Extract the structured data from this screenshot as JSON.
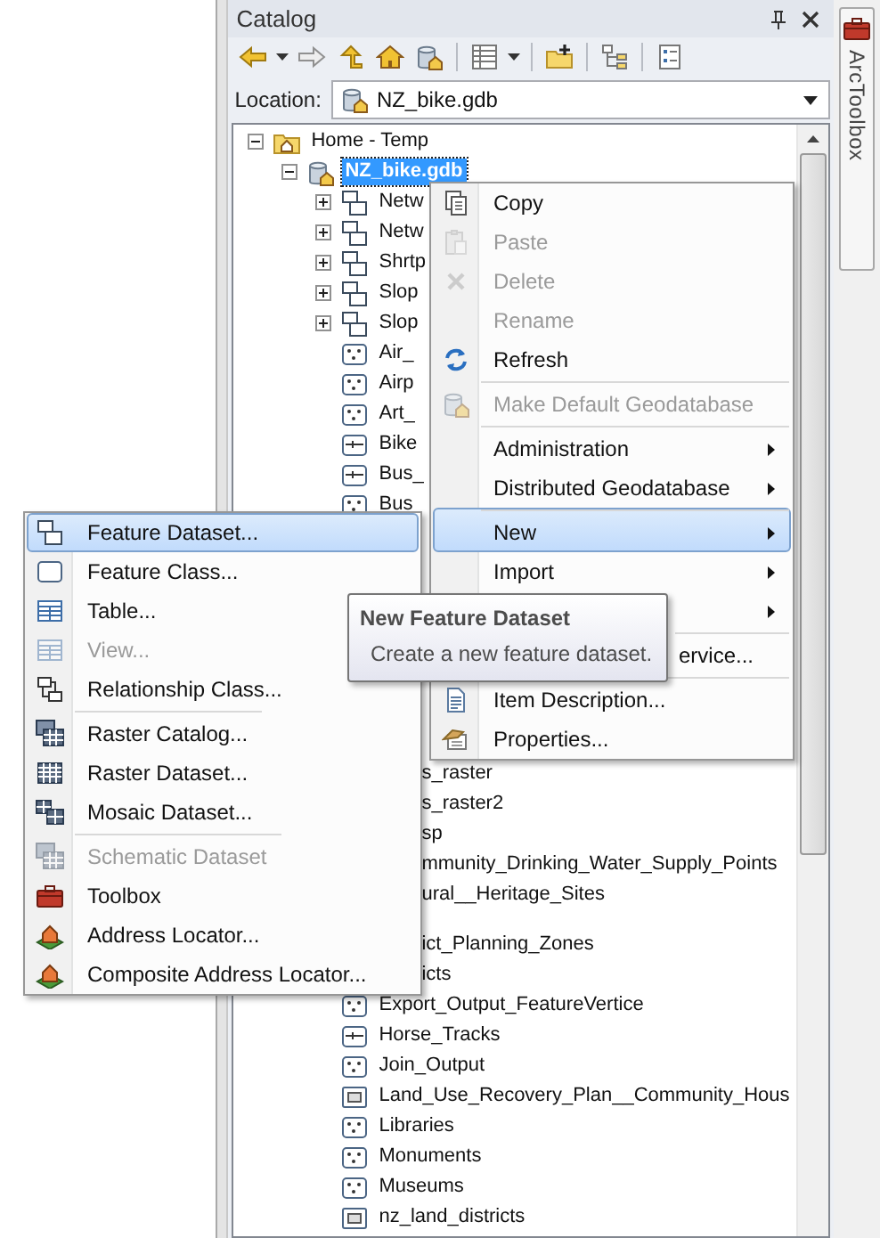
{
  "catalog": {
    "title": "Catalog"
  },
  "location": {
    "label": "Location:",
    "value": "NZ_bike.gdb"
  },
  "side_tab": {
    "label": "ArcToolbox"
  },
  "tree": {
    "items": [
      {
        "label": "Home - Temp",
        "kind": "folder",
        "expanded": true,
        "selected": false,
        "children": [
          {
            "label": "NZ_bike.gdb",
            "kind": "gdb",
            "expanded": true,
            "selected": true,
            "children": [
              {
                "label": "Netw",
                "kind": "dataset",
                "expanded": false,
                "selected": false
              },
              {
                "label": "Netw",
                "kind": "dataset",
                "expanded": false,
                "selected": false
              },
              {
                "label": "Shrtp",
                "kind": "dataset",
                "expanded": false,
                "selected": false
              },
              {
                "label": "Slop",
                "kind": "dataset",
                "expanded": false,
                "selected": false
              },
              {
                "label": "Slop",
                "kind": "dataset",
                "expanded": false,
                "selected": false
              },
              {
                "label": "Air_",
                "kind": "point",
                "selected": false
              },
              {
                "label": "Airp",
                "kind": "point",
                "selected": false
              },
              {
                "label": "Art_",
                "kind": "point",
                "selected": false
              },
              {
                "label": "Bike",
                "kind": "line",
                "selected": false
              },
              {
                "label": "Bus_",
                "kind": "line",
                "selected": false
              },
              {
                "label": "Bus",
                "kind": "point",
                "selected": false
              },
              {
                "label": "s_raster",
                "kind": "clipped",
                "selected": false
              },
              {
                "label": "s_raster2",
                "kind": "clipped",
                "selected": false
              },
              {
                "label": "sp",
                "kind": "clipped",
                "selected": false
              },
              {
                "label": "mmunity_Drinking_Water_Supply_Points",
                "kind": "clipped",
                "selected": false
              },
              {
                "label": "ural__Heritage_Sites",
                "kind": "clipped",
                "selected": false
              },
              {
                "label": "ict_Planning_Zones",
                "kind": "clipped",
                "selected": false
              },
              {
                "label": "icts",
                "kind": "clipped",
                "selected": false
              },
              {
                "label": "Export_Output_FeatureVertice",
                "kind": "point",
                "selected": false
              },
              {
                "label": "Horse_Tracks",
                "kind": "line",
                "selected": false
              },
              {
                "label": "Join_Output",
                "kind": "point",
                "selected": false
              },
              {
                "label": "Land_Use_Recovery_Plan__Community_Hous",
                "kind": "polygon",
                "selected": false
              },
              {
                "label": "Libraries",
                "kind": "point",
                "selected": false
              },
              {
                "label": "Monuments",
                "kind": "point",
                "selected": false
              },
              {
                "label": "Museums",
                "kind": "point",
                "selected": false
              },
              {
                "label": "nz_land_districts",
                "kind": "polygon",
                "selected": false
              }
            ]
          }
        ]
      }
    ]
  },
  "context_menu": {
    "items": [
      {
        "label": "Copy",
        "kind": "plain",
        "disabled": false,
        "submenu": false,
        "selected": false,
        "separator_before": false
      },
      {
        "label": "Paste",
        "kind": "plain",
        "disabled": true,
        "submenu": false,
        "selected": false,
        "separator_before": false
      },
      {
        "label": "Delete",
        "kind": "plain",
        "disabled": true,
        "submenu": false,
        "selected": false,
        "separator_before": false
      },
      {
        "label": "Rename",
        "kind": "plain",
        "disabled": true,
        "submenu": false,
        "selected": false,
        "separator_before": false
      },
      {
        "label": "Refresh",
        "kind": "plain",
        "disabled": false,
        "submenu": false,
        "selected": false,
        "separator_before": false
      },
      {
        "label": "Make Default Geodatabase",
        "kind": "plain",
        "disabled": true,
        "submenu": false,
        "selected": false,
        "separator_before": true
      },
      {
        "label": "Administration",
        "kind": "plain",
        "disabled": false,
        "submenu": true,
        "selected": false,
        "separator_before": true
      },
      {
        "label": "Distributed Geodatabase",
        "kind": "plain",
        "disabled": false,
        "submenu": true,
        "selected": false,
        "separator_before": false
      },
      {
        "label": "New",
        "kind": "plain",
        "disabled": false,
        "submenu": true,
        "selected": true,
        "separator_before": true
      },
      {
        "label": "Import",
        "kind": "plain",
        "disabled": false,
        "submenu": true,
        "selected": false,
        "separator_before": false
      },
      {
        "kind": "plain",
        "disabled": false,
        "submenu": true,
        "selected": false,
        "separator_before": false
      },
      {
        "label": "ervice...",
        "kind": "clipped",
        "disabled": false,
        "submenu": false,
        "selected": false,
        "separator_before": true
      },
      {
        "label": "Item Description...",
        "kind": "plain",
        "disabled": false,
        "submenu": false,
        "selected": false,
        "separator_before": true
      },
      {
        "label": "Properties...",
        "kind": "plain",
        "disabled": false,
        "submenu": false,
        "selected": false,
        "separator_before": false
      }
    ]
  },
  "submenu": {
    "items": [
      {
        "label": "Feature Dataset...",
        "disabled": false,
        "selected": true,
        "separator_before": false
      },
      {
        "label": "Feature Class...",
        "disabled": false,
        "selected": false,
        "separator_before": false
      },
      {
        "label": "Table...",
        "disabled": false,
        "selected": false,
        "separator_before": false
      },
      {
        "label": "View...",
        "disabled": true,
        "selected": false,
        "separator_before": false
      },
      {
        "label": "Relationship Class...",
        "disabled": false,
        "selected": false,
        "separator_before": false
      },
      {
        "label": "Raster Catalog...",
        "disabled": false,
        "selected": false,
        "separator_before": true
      },
      {
        "label": "Raster Dataset...",
        "disabled": false,
        "selected": false,
        "separator_before": false
      },
      {
        "label": "Mosaic Dataset...",
        "disabled": false,
        "selected": false,
        "separator_before": false
      },
      {
        "label": "Schematic Dataset",
        "disabled": true,
        "selected": false,
        "separator_before": true
      },
      {
        "label": "Toolbox",
        "disabled": false,
        "selected": false,
        "separator_before": false
      },
      {
        "label": "Address Locator...",
        "disabled": false,
        "selected": false,
        "separator_before": false
      },
      {
        "label": "Composite Address Locator...",
        "disabled": false,
        "selected": false,
        "separator_before": false
      }
    ]
  },
  "tooltip": {
    "title": "New Feature Dataset",
    "text": "Create a new feature dataset."
  }
}
